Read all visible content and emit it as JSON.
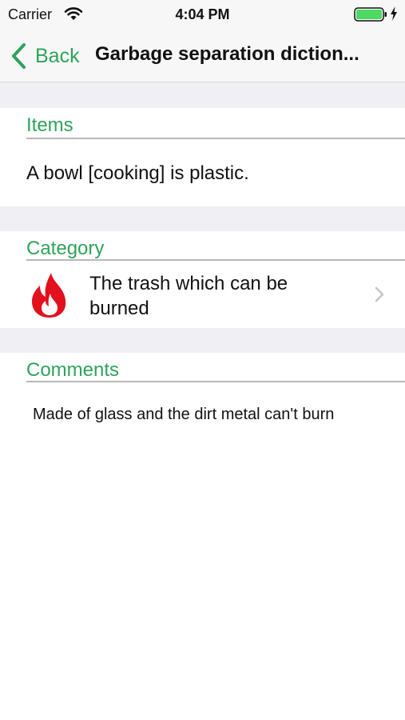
{
  "status": {
    "carrier": "Carrier",
    "time": "4:04 PM"
  },
  "nav": {
    "back_label": "Back",
    "title": "Garbage separation diction..."
  },
  "items": {
    "header": "Items",
    "value": "A bowl [cooking] is plastic."
  },
  "category": {
    "header": "Category",
    "value": "The trash which can be burned",
    "icon": "fire-icon"
  },
  "comments": {
    "header": "Comments",
    "value": "Made of glass and the dirt metal can't burn"
  },
  "colors": {
    "accent": "#2fa35a",
    "fire": "#e3101d",
    "separator_bg": "#efeff4"
  }
}
